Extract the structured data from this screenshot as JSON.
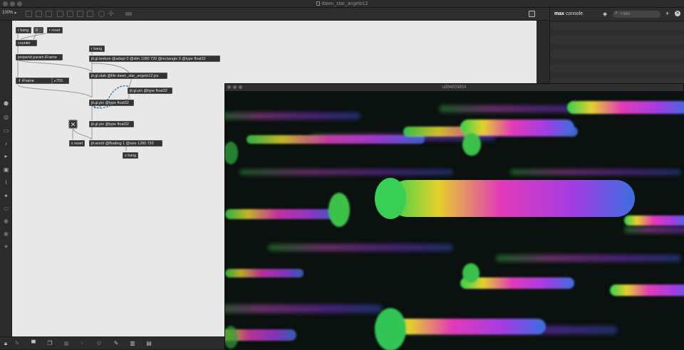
{
  "window": {
    "title": "dawn_star_angelo12"
  },
  "toolbar": {
    "zoom": "100%"
  },
  "patcher": {
    "objects": {
      "r_bang_1": "r bang",
      "num_box": "0",
      "r_reset": "r reset",
      "counter": "counter",
      "prepend": "prepend param iFrame",
      "iframe_label": "iFrame",
      "iframe_value": "703.",
      "r_bang_2": "r bang",
      "texture": "jit.gl.texture @adapt 0 @dim 1280 720 @rectangle 0 @type float32",
      "slab": "jit.gl.slab @file dawn_star_angelo12.jxs",
      "pix_right": "jit.gl.pix @type float32",
      "pix_1": "jit.gl.pix @type float32",
      "pix_2": "jit.gl.pix @type float32",
      "s_reset": "s reset",
      "world": "jit.world @floating 1 @size 1280 720",
      "s_bang": "s bang"
    }
  },
  "console": {
    "title_bold": "max",
    "title_rest": " console",
    "filter_placeholder": "Filter"
  },
  "jit_window": {
    "title": "u994003854"
  },
  "colors": {
    "patcher_bg": "#e8e8e8",
    "object_bg": "#333333",
    "ui_dark": "#2b2b2b"
  },
  "icons": [
    "close-icon",
    "minimize-icon",
    "maximize-icon",
    "document-icon",
    "console-icon",
    "diamond-icon",
    "search-icon",
    "plus-icon",
    "clear-icon",
    "lock-icon",
    "wrench-icon"
  ]
}
